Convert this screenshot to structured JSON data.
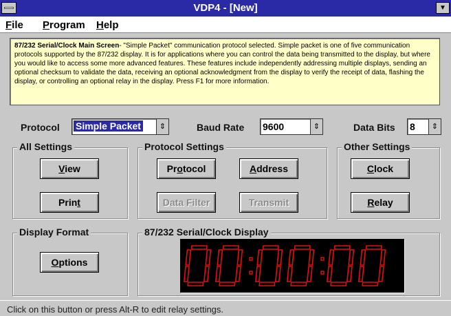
{
  "window": {
    "title": "VDP4 - [New]"
  },
  "menu": {
    "items": [
      {
        "key": "F",
        "rest": "ile"
      },
      {
        "key": "P",
        "rest": "rogram"
      },
      {
        "key": "H",
        "rest": "elp"
      }
    ]
  },
  "help": {
    "heading": "87/232 Serial/Clock Main Screen",
    "text": "- \"Simple Packet\" communication protocol selected. Simple packet is one of five communication protocols supported by the 87/232 display. It is for applications where you can control the data being transmitted to the display, but where you would like to access some more advanced features. These features include independently addressing multiple displays, sending an optional checksum to validate the data, receiving an optional acknowledgment from the display to verify the receipt of data, flashing the display, or controlling an optional relay in the display. Press F1 for more information."
  },
  "settings": {
    "protocol_label": "Protocol",
    "protocol_value": "Simple Packet",
    "baud_label": "Baud Rate",
    "baud_value": "9600",
    "databits_label": "Data Bits",
    "databits_value": "8"
  },
  "groups": {
    "all_settings": "All Settings",
    "protocol_settings": "Protocol Settings",
    "other_settings": "Other Settings",
    "display_format": "Display Format",
    "serial_display": "87/232 Serial/Clock Display"
  },
  "buttons": {
    "view": {
      "key": "V",
      "rest": "iew"
    },
    "print": {
      "pre": "Prin",
      "key": "t",
      "rest": ""
    },
    "protocol": {
      "pre": "Pr",
      "key": "o",
      "rest": "tocol"
    },
    "address": {
      "key": "A",
      "rest": "ddress"
    },
    "data_filter": "Data Filter",
    "transmit": "Transmit",
    "clock": {
      "key": "C",
      "rest": "lock"
    },
    "relay": {
      "key": "R",
      "rest": "elay"
    },
    "options": {
      "key": "O",
      "rest": "ptions"
    }
  },
  "clock_display": {
    "digits": [
      "0",
      "0",
      "0",
      "0",
      "0",
      "0"
    ],
    "color": "#e01010"
  },
  "status": {
    "text": "Click on this button or press Alt-R to edit relay settings."
  },
  "colors": {
    "titlebar": "#2a2aa6",
    "help_bg": "#ffffc8",
    "face": "#c8c8c8"
  }
}
